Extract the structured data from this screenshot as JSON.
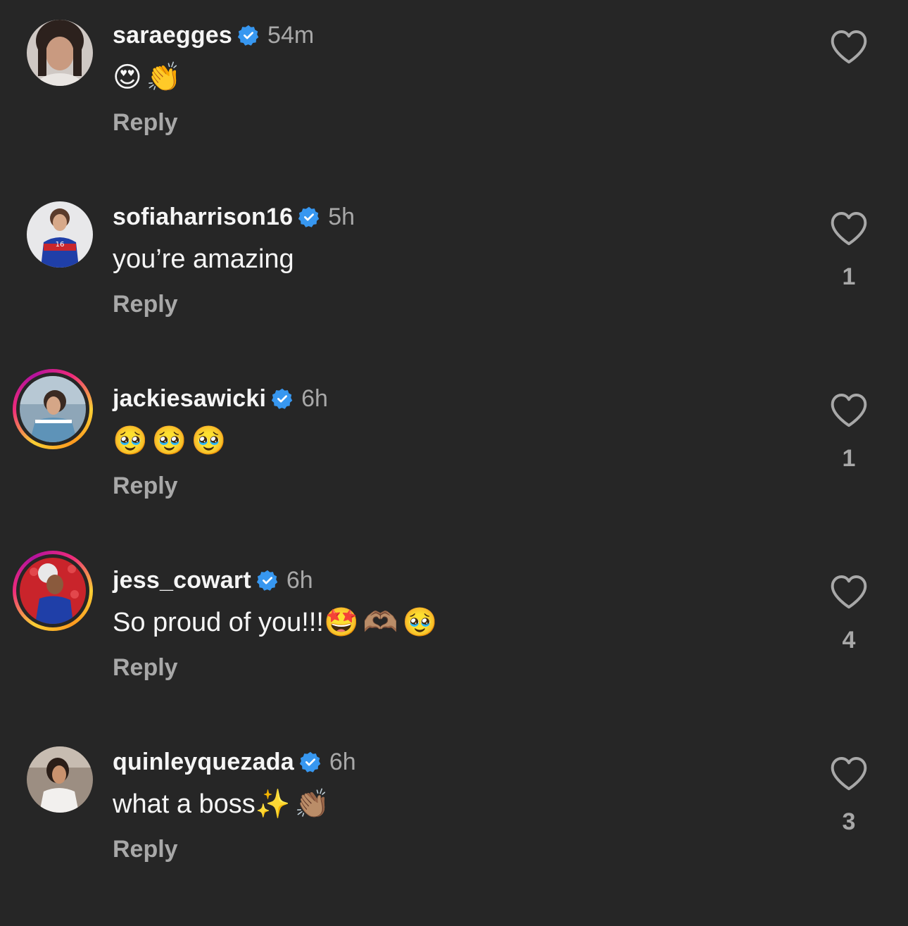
{
  "colors": {
    "background": "#262626",
    "primary_text": "#f5f5f5",
    "secondary_text": "#a8a8a8",
    "verified_blue": "#3797f0"
  },
  "comments": [
    {
      "username": "saraegges",
      "time": "54m",
      "verified": true,
      "story_ring": false,
      "text": "",
      "emojis": [
        "😍",
        "👏"
      ],
      "reply_label": "Reply",
      "like_count": "",
      "icon": "heart-outline-icon"
    },
    {
      "username": "sofiaharrison16",
      "time": "5h",
      "verified": true,
      "story_ring": false,
      "text": "you’re amazing",
      "emojis": [],
      "reply_label": "Reply",
      "like_count": "1",
      "icon": "heart-outline-icon"
    },
    {
      "username": "jackiesawicki",
      "time": "6h",
      "verified": true,
      "story_ring": true,
      "text": "",
      "emojis": [
        "🥹",
        "🥹",
        "🥹"
      ],
      "reply_label": "Reply",
      "like_count": "1",
      "icon": "heart-outline-icon"
    },
    {
      "username": "jess_cowart",
      "time": "6h",
      "verified": true,
      "story_ring": true,
      "text": "So proud of you!!!",
      "emojis": [
        "🤩",
        "🫶🏽",
        "🥹"
      ],
      "reply_label": "Reply",
      "like_count": "4",
      "icon": "heart-outline-icon"
    },
    {
      "username": "quinleyquezada",
      "time": "6h",
      "verified": true,
      "story_ring": false,
      "text": "what a boss",
      "emojis": [
        "✨",
        "👏🏽"
      ],
      "reply_label": "Reply",
      "like_count": "3",
      "icon": "heart-outline-icon"
    }
  ]
}
